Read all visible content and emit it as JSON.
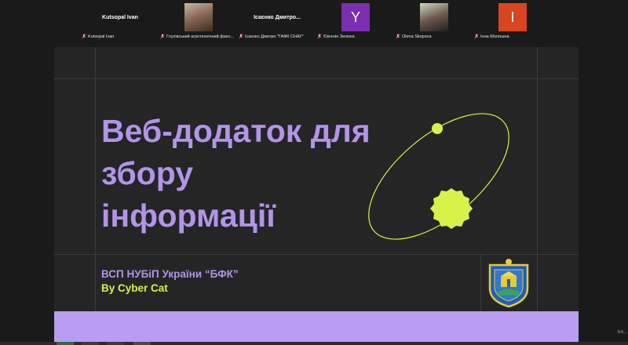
{
  "participants": [
    {
      "tile_text": "Kutsopal Ivan",
      "caption": "Kutsopal Ivan",
      "avatar": "none"
    },
    {
      "tile_text": "",
      "caption": "Глухівський агротехнічний фахо...",
      "avatar": "photo-man"
    },
    {
      "tile_text": "Ісаєнко  Дмитро...",
      "caption": "Ісаєнко Дмитро \"ГАФК СНАУ\"",
      "avatar": "none"
    },
    {
      "tile_text": "Y",
      "caption": "Євгенія Зелюка",
      "avatar": "letter",
      "color": "#7b2fb0"
    },
    {
      "tile_text": "",
      "caption": "Olena Skopova",
      "avatar": "photo-woman"
    },
    {
      "tile_text": "І",
      "caption": "Інна Молошна",
      "avatar": "letter",
      "color": "#d9451f"
    }
  ],
  "slide": {
    "title_lines": [
      "Веб-додаток для",
      "збору",
      "інформації"
    ],
    "subtitle": "ВСП НУБіП України “БФК”",
    "byline": "By Cyber Cat"
  },
  "corner_text": "9:4...",
  "colors": {
    "purple": "#b294e8",
    "lime": "#d8f24a",
    "band": "#b99df0",
    "slide_bg": "#252525"
  }
}
